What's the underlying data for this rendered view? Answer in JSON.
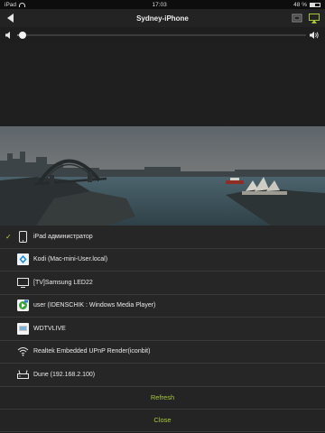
{
  "status_bar": {
    "device": "iPad",
    "time": "17:03",
    "battery": "48 %"
  },
  "nav": {
    "title": "Sydney-iPhone"
  },
  "volume": {
    "level": 0.02
  },
  "devices": [
    {
      "label": "iPad администратор",
      "icon": "ipad-icon",
      "selected": true
    },
    {
      "label": "Kodi (Mac-mini-User.local)",
      "icon": "kodi-icon",
      "selected": false
    },
    {
      "label": "[TV]Samsung LED22",
      "icon": "tv-icon",
      "selected": false
    },
    {
      "label": "user (IDENSCHIK : Windows Media Player)",
      "icon": "windows-media-player-icon",
      "selected": false
    },
    {
      "label": "WDTVLIVE",
      "icon": "media-player-icon",
      "selected": false
    },
    {
      "label": "Realtek Embedded UPnP Render(iconbit)",
      "icon": "wifi-icon",
      "selected": false
    },
    {
      "label": "Dune (192.168.2.100)",
      "icon": "router-icon",
      "selected": false
    }
  ],
  "actions": {
    "refresh": "Refresh",
    "close": "Close"
  },
  "colors": {
    "accent": "#a7c83a",
    "check": "#b7d33c"
  }
}
